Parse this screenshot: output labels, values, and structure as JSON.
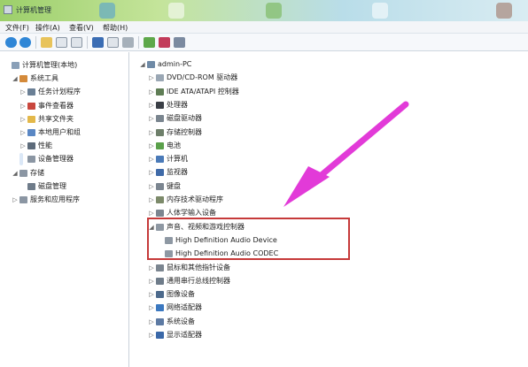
{
  "window": {
    "title": "计算机管理"
  },
  "menu": [
    "文件(F)",
    "操作(A)",
    "查看(V)",
    "帮助(H)"
  ],
  "toolbar_icons": [
    "back-arrow-icon",
    "forward-arrow-icon",
    "up-folder-icon",
    "show-tree-icon",
    "properties-icon",
    "help-icon",
    "export-icon",
    "refresh-icon",
    "update-driver-icon",
    "uninstall-icon",
    "scan-hardware-icon"
  ],
  "left_tree": [
    {
      "label": "计算机管理(本地)",
      "expander": "",
      "icon": "computer-manage-icon",
      "level": 0
    },
    {
      "label": "系统工具",
      "expander": "◢",
      "icon": "tools-icon",
      "level": 1
    },
    {
      "label": "任务计划程序",
      "expander": "▷",
      "icon": "clock-icon",
      "level": 2
    },
    {
      "label": "事件查看器",
      "expander": "▷",
      "icon": "event-viewer-icon",
      "level": 2
    },
    {
      "label": "共享文件夹",
      "expander": "▷",
      "icon": "shared-folder-icon",
      "level": 2
    },
    {
      "label": "本地用户和组",
      "expander": "▷",
      "icon": "users-icon",
      "level": 2
    },
    {
      "label": "性能",
      "expander": "▷",
      "icon": "performance-icon",
      "level": 2
    },
    {
      "label": "设备管理器",
      "expander": "",
      "icon": "device-manager-icon",
      "level": 2,
      "selected": true
    },
    {
      "label": "存储",
      "expander": "◢",
      "icon": "storage-icon",
      "level": 1
    },
    {
      "label": "磁盘管理",
      "expander": "",
      "icon": "disk-icon",
      "level": 2
    },
    {
      "label": "服务和应用程序",
      "expander": "▷",
      "icon": "services-icon",
      "level": 1
    }
  ],
  "right_tree": [
    {
      "label": "admin-PC",
      "expander": "◢",
      "icon": "pc-icon",
      "level": 0
    },
    {
      "label": "DVD/CD-ROM 驱动器",
      "expander": "▷",
      "icon": "dvd-icon",
      "level": 1
    },
    {
      "label": "IDE ATA/ATAPI 控制器",
      "expander": "▷",
      "icon": "ide-icon",
      "level": 1
    },
    {
      "label": "处理器",
      "expander": "▷",
      "icon": "cpu-icon",
      "level": 1
    },
    {
      "label": "磁盘驱动器",
      "expander": "▷",
      "icon": "disk-drive-icon",
      "level": 1
    },
    {
      "label": "存储控制器",
      "expander": "▷",
      "icon": "storage-controller-icon",
      "level": 1
    },
    {
      "label": "电池",
      "expander": "▷",
      "icon": "battery-icon",
      "level": 1
    },
    {
      "label": "计算机",
      "expander": "▷",
      "icon": "computer-icon",
      "level": 1
    },
    {
      "label": "监视器",
      "expander": "▷",
      "icon": "monitor-icon",
      "level": 1
    },
    {
      "label": "键盘",
      "expander": "▷",
      "icon": "keyboard-icon",
      "level": 1
    },
    {
      "label": "内存技术驱动程序",
      "expander": "▷",
      "icon": "memory-icon",
      "level": 1
    },
    {
      "label": "人体学输入设备",
      "expander": "▷",
      "icon": "hid-icon",
      "level": 1
    },
    {
      "label": "声音、视频和游戏控制器",
      "expander": "◢",
      "icon": "speaker-icon",
      "level": 1
    },
    {
      "label": "High Definition Audio Device",
      "expander": "",
      "icon": "audio-device-icon",
      "level": 2
    },
    {
      "label": "High Definition Audio CODEC",
      "expander": "",
      "icon": "audio-device-icon",
      "level": 2
    },
    {
      "label": "鼠标和其他指针设备",
      "expander": "▷",
      "icon": "mouse-icon",
      "level": 1
    },
    {
      "label": "通用串行总线控制器",
      "expander": "▷",
      "icon": "usb-icon",
      "level": 1
    },
    {
      "label": "图像设备",
      "expander": "▷",
      "icon": "camera-icon",
      "level": 1
    },
    {
      "label": "网络适配器",
      "expander": "▷",
      "icon": "network-icon",
      "level": 1
    },
    {
      "label": "系统设备",
      "expander": "▷",
      "icon": "system-device-icon",
      "level": 1
    },
    {
      "label": "显示适配器",
      "expander": "▷",
      "icon": "display-adapter-icon",
      "level": 1
    }
  ],
  "colors": {
    "arrow": "#e23ad8",
    "highlight": "#c63a3a"
  }
}
